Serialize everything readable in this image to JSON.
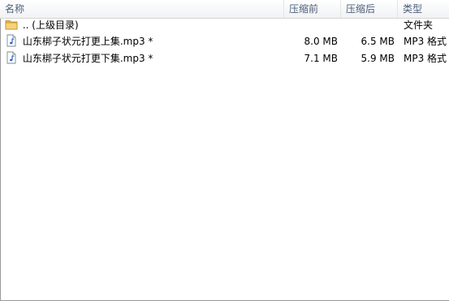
{
  "columns": {
    "name": "名称",
    "size": "压缩前",
    "packed": "压缩后",
    "type": "类型"
  },
  "rows": [
    {
      "icon": "folder-icon",
      "name": ".. (上级目录)",
      "size": "",
      "packed": "",
      "type": "文件夹"
    },
    {
      "icon": "audio-file-icon",
      "name": "山东梆子状元打更上集.mp3 *",
      "size": "8.0 MB",
      "packed": "6.5 MB",
      "type": "MP3 格式"
    },
    {
      "icon": "audio-file-icon",
      "name": "山东梆子状元打更下集.mp3 *",
      "size": "7.1 MB",
      "packed": "5.9 MB",
      "type": "MP3 格式"
    }
  ]
}
